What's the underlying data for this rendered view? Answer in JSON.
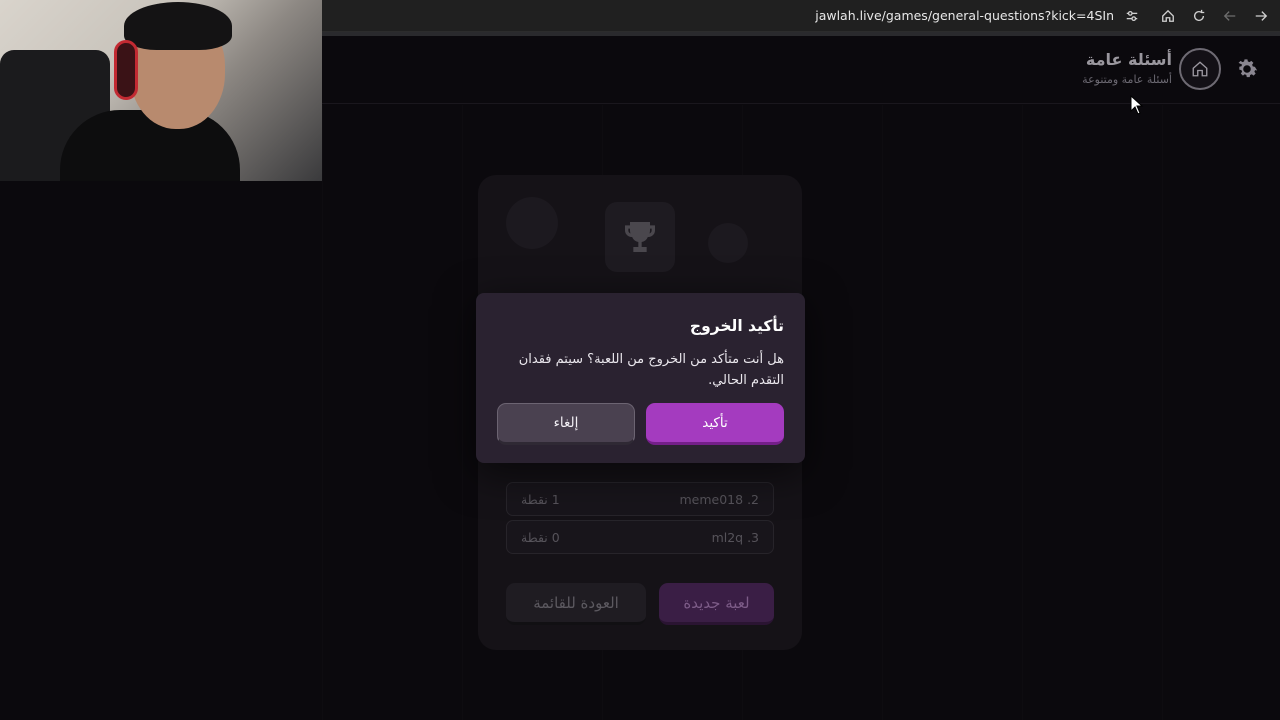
{
  "browser": {
    "url": "jawlah.live/games/general-questions?kick=4SIn"
  },
  "header": {
    "title": "أسئلة عامة",
    "subtitle": "أسئلة عامة ومتنوعة"
  },
  "card": {
    "leaderboard": [
      {
        "rank_name": "meme018 .2",
        "points": "1 نقطة"
      },
      {
        "rank_name": "ml2q .3",
        "points": "0 نقطة"
      }
    ],
    "back_button": "العودة للقائمة",
    "new_game_button": "لعبة جديدة"
  },
  "modal": {
    "title": "تأكيد الخروج",
    "message": "هل أنت متأكد من الخروج من اللعبة؟ سيتم فقدان التقدم الحالي.",
    "confirm_label": "تأكيد",
    "cancel_label": "إلغاء"
  },
  "colors": {
    "background": "#0b090d",
    "modal": "#2a2230",
    "accent": "#a43bbf"
  },
  "icons": [
    "site-settings-icon",
    "home-icon",
    "reload-icon",
    "back-arrow-icon",
    "forward-arrow-icon",
    "gear-icon",
    "trophy-icon"
  ]
}
